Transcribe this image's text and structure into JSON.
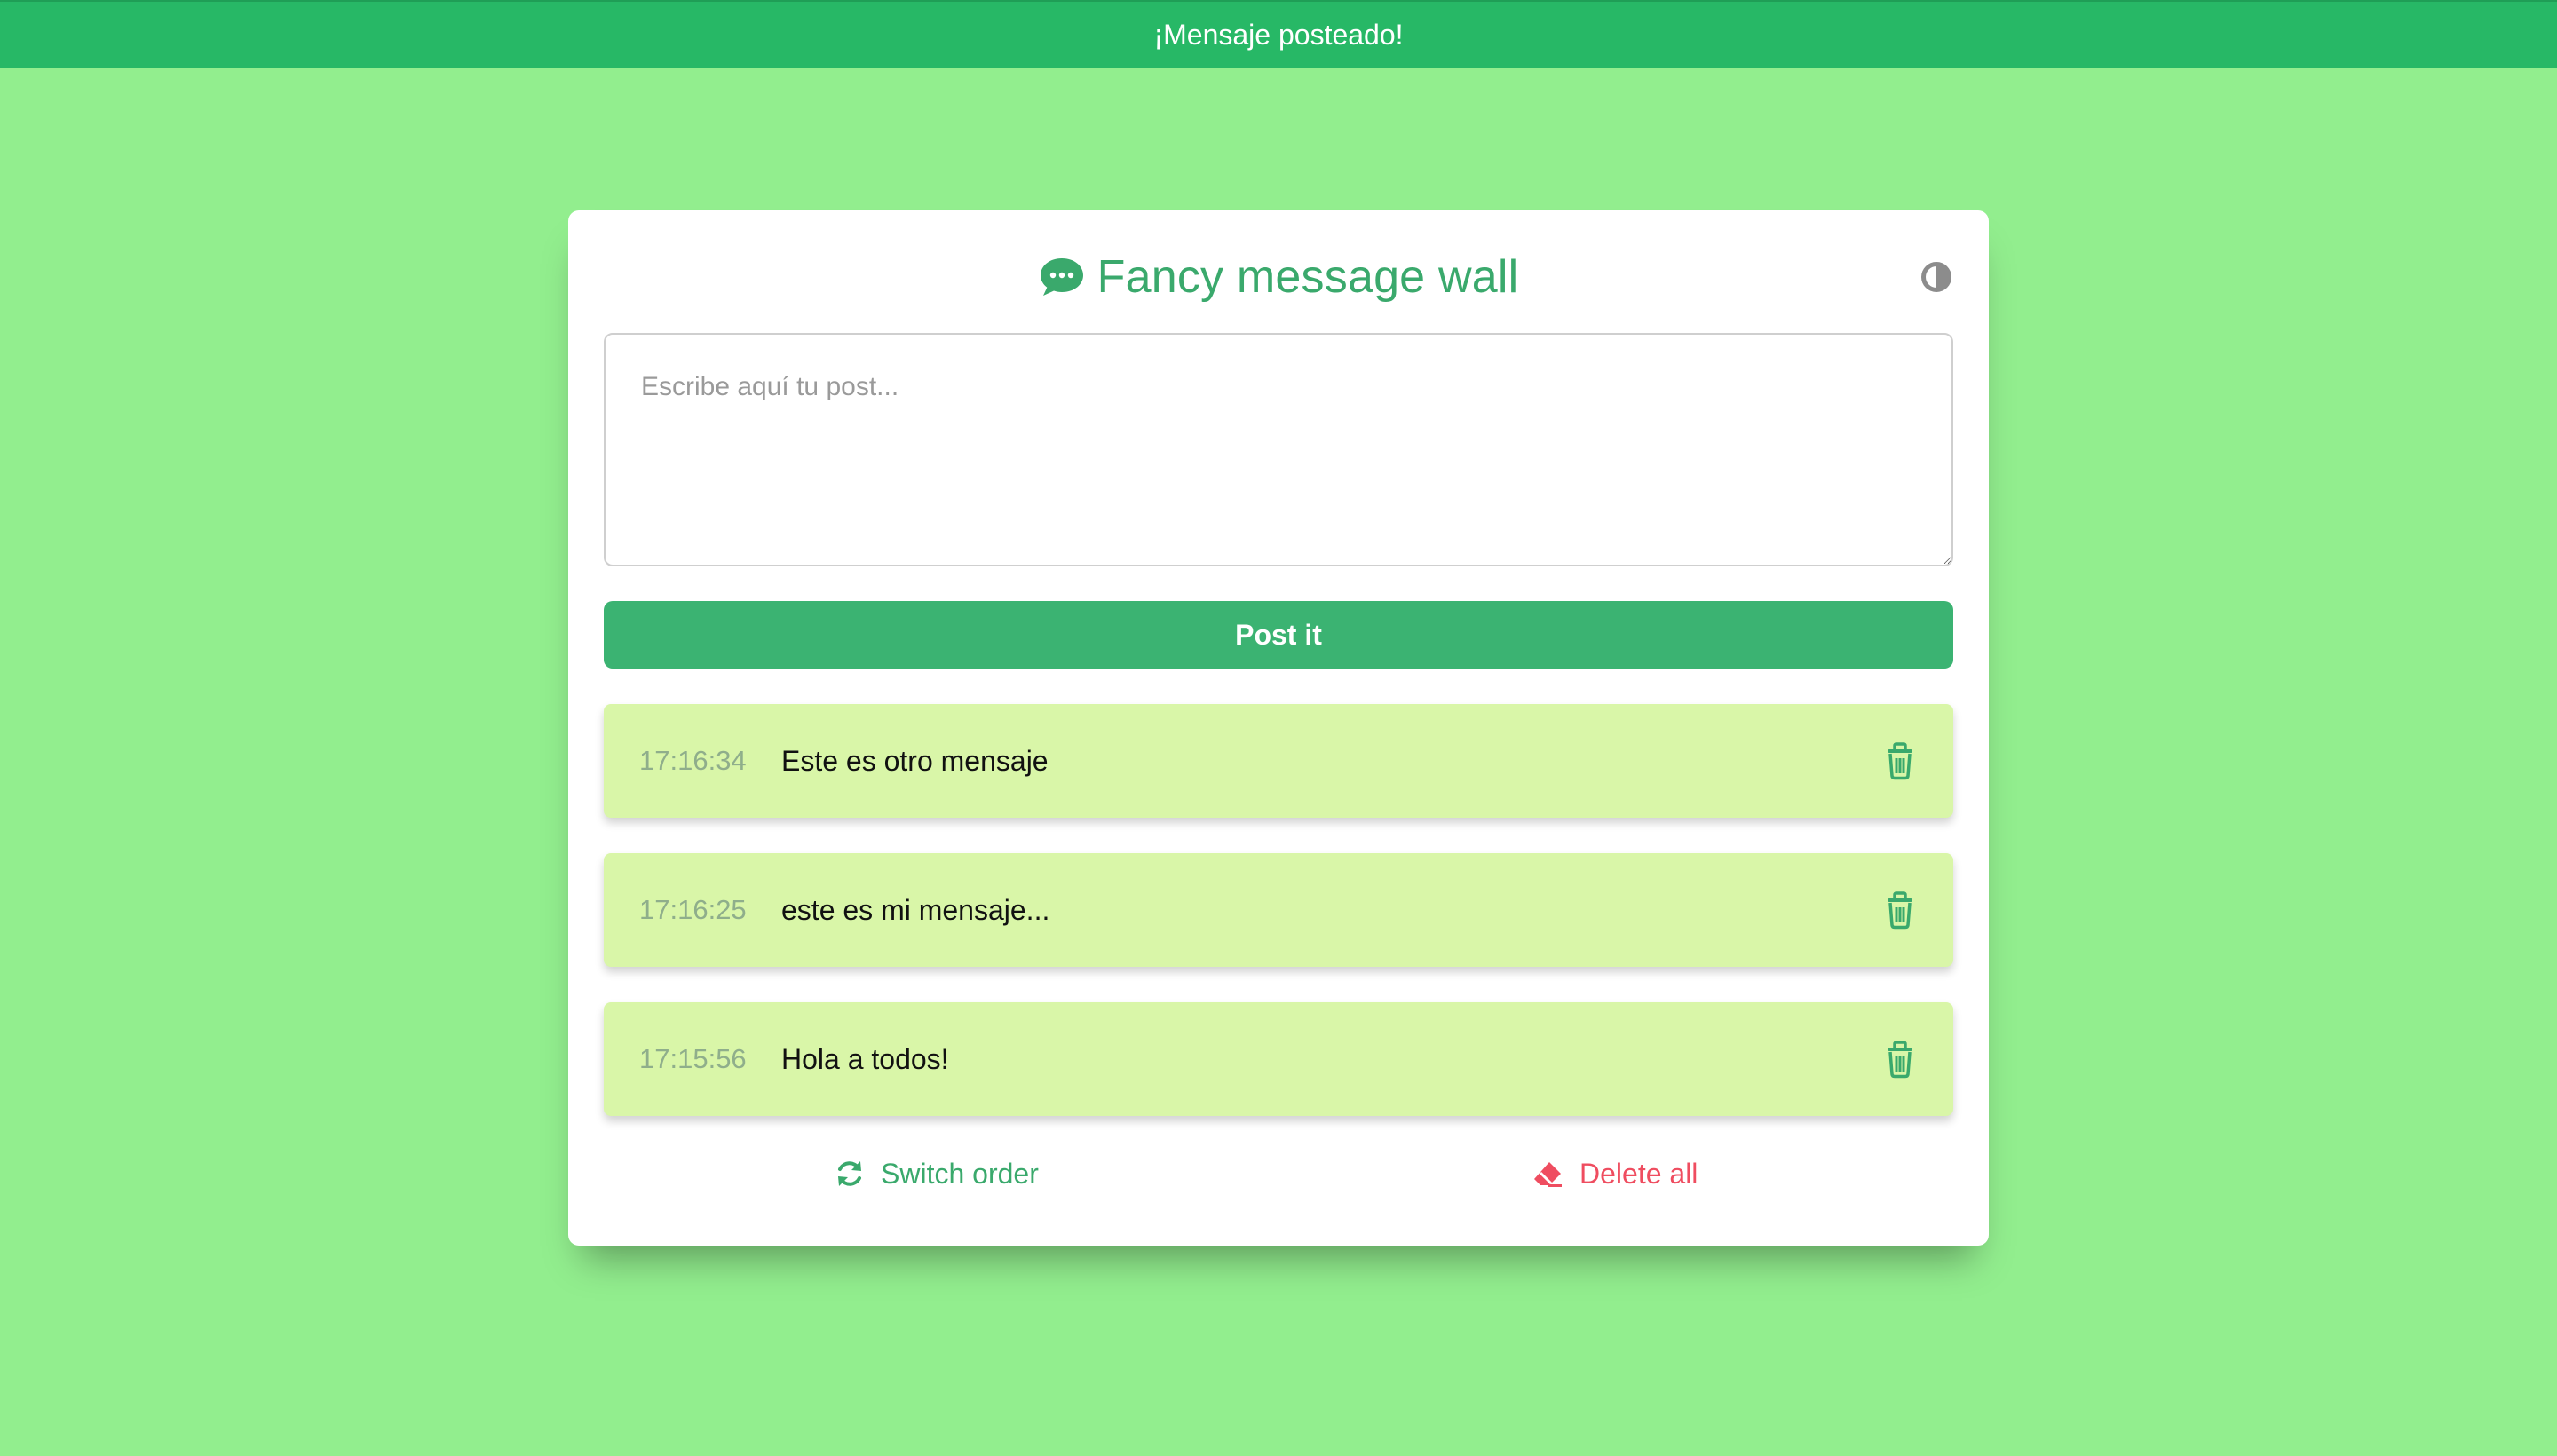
{
  "toast": {
    "message": "¡Mensaje posteado!"
  },
  "header": {
    "title": "Fancy message wall",
    "icon": "speech-bubble-icon"
  },
  "composer": {
    "placeholder": "Escribe aquí tu post...",
    "value": "",
    "button_label": "Post it"
  },
  "messages": [
    {
      "time": "17:16:34",
      "text": "Este es otro mensaje"
    },
    {
      "time": "17:16:25",
      "text": "este es mi mensaje..."
    },
    {
      "time": "17:15:56",
      "text": "Hola a todos!"
    }
  ],
  "footer": {
    "switch_order_label": "Switch order",
    "delete_all_label": "Delete all"
  },
  "colors": {
    "background": "#92ee8e",
    "toast": "#27b866",
    "accent": "#3bb372",
    "message_bg": "#d9f6a8",
    "danger": "#ef4d60"
  }
}
